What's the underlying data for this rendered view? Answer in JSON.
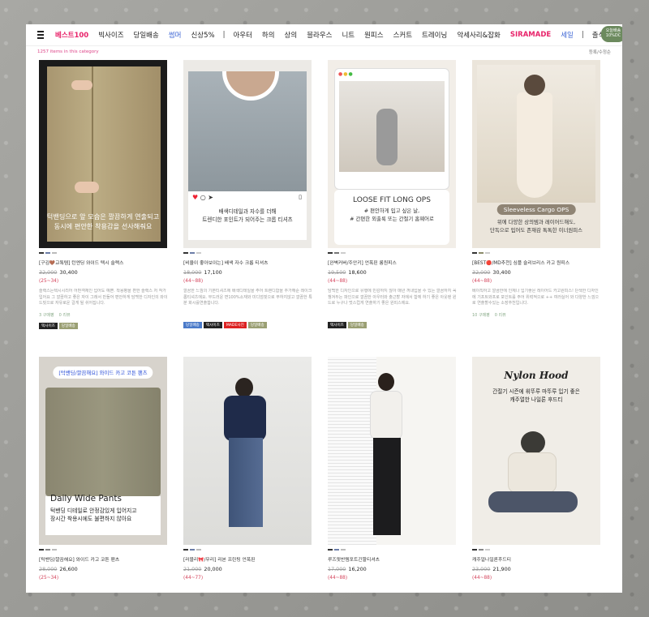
{
  "nav": {
    "items": [
      {
        "label": "베스트100",
        "color": "#e8236a",
        "bold": true
      },
      {
        "label": "빅사이즈",
        "color": "#222"
      },
      {
        "label": "당일배송",
        "color": "#222"
      },
      {
        "label": "썸머",
        "color": "#3b64d4"
      },
      {
        "label": "신상5%",
        "color": "#222"
      },
      {
        "label": "|",
        "sep": true
      },
      {
        "label": "아우터",
        "color": "#222"
      },
      {
        "label": "하의",
        "color": "#222"
      },
      {
        "label": "상의",
        "color": "#222"
      },
      {
        "label": "블라우스",
        "color": "#222"
      },
      {
        "label": "니트",
        "color": "#222"
      },
      {
        "label": "원피스",
        "color": "#222"
      },
      {
        "label": "스커트",
        "color": "#222"
      },
      {
        "label": "트레이닝",
        "color": "#222"
      },
      {
        "label": "악세사리&잡화",
        "color": "#222"
      },
      {
        "label": "SIRAMADE",
        "color": "#e8236a",
        "bold": true
      },
      {
        "label": "세일",
        "color": "#3b64d4"
      },
      {
        "label": "|",
        "sep": true
      },
      {
        "label": "출석체크",
        "color": "#222"
      }
    ],
    "today_badge": "오늘배송\n10%DC"
  },
  "subbar": {
    "count_text": "1257 items in this category",
    "sort_label": "등록/수정순"
  },
  "products": [
    {
      "name": "[구김🤎교톡템] 턴엔딩 와이드 텍시 슬랙스",
      "old_price": "32,000",
      "price": "30,400",
      "sale": "(25~34)",
      "desc": "슬랙스는텍시시리어 어떤객체인 입어도 예쁜. 착용평을 편한 슬랙스 저 작가입어요 그 깔끔하고 좋은 자이 그래서 만들어 편안하게 담백한 디자인의 와이드핏으로 자유로운 걸게 될 쉬어집니다.",
      "reviews": "3 구매평",
      "qna": "0 리뷰",
      "tags": [
        {
          "text": "택사이즈",
          "kind": "black"
        },
        {
          "text": "당일배송",
          "kind": "olive"
        }
      ],
      "colors": [
        "#333",
        "#6c7da8",
        "#bbb"
      ],
      "image_text": "턱밴딩으로 앞 모습은 깔끔하게 연출되고\n동시에 편안한 착용감을 선사해줘요"
    },
    {
      "name": "[비율이 좋아보이는] 배색 자수 크롭 티셔츠",
      "old_price": "18,000",
      "price": "17,100",
      "sale": "(44~88)",
      "desc": "깔끔한 느낌의 기본티셔츠에 배색디테일을 주어 트렌디함을 추가해준 레이크롭티셔츠에요. 부드러운 면100%소재와 미디엄핏으로 부하지않고 깔끔한 특분 화시를연출합니다.",
      "reviews": "",
      "qna": "",
      "tags": [
        {
          "text": "당일배송",
          "kind": "blue"
        },
        {
          "text": "택사이즈",
          "kind": "black"
        },
        {
          "text": "MADE사진",
          "kind": "red"
        },
        {
          "text": "당일배송",
          "kind": "olive"
        }
      ],
      "colors": [
        "#333",
        "#6c7da8",
        "#ccc"
      ],
      "image_text": "배색디테일과 자수를 더해\n트렌디한 포인트가 되어주는 크롭 티셔츠"
    },
    {
      "name": "[완벽커버/주안키] 언폭핀 롱원피스",
      "old_price": "19,500",
      "price": "18,600",
      "sale": "(44~88)",
      "desc": "담백한 디자인으로 유행에 민감하지 않아 매년 꺼내입을 수 있는 깔끔하지 꼭 챙겨두는 파인으로 깔끔한 아우터와 출근할 자에서 함께 하기 좋은 아웃텐 윈드로 누구나 멋스럽게 연출하기 좋은 원피스에요.",
      "reviews": "",
      "qna": "",
      "tags": [
        {
          "text": "택사이즈",
          "kind": "black"
        },
        {
          "text": "당일배송",
          "kind": "olive"
        }
      ],
      "colors": [
        "#333",
        "#777",
        "#ccc"
      ],
      "image_title": "LOOSE FIT LONG OPS",
      "image_text": "# 편안하게 입고 싶은 날,\n# 간편한 외출룩 또는 간절기 홈웨어로"
    },
    {
      "name": "[BEST🔴/MD추천] 심플 슬리브리스 카고 원피스",
      "old_price": "32,000",
      "price": "30,400",
      "sale": "(44~88)",
      "desc": "베이직하고 깔끔한에 인체나 입기좋은 레이어드 카고원피스! 단색한 디자인에 기프트와프로 포인트를 주어 위력적으로 ++ 여러실어 와 다양한 느낌으로 연출할수있는 소장추천입니다.",
      "reviews": "10 구매평",
      "qna": "0 리뷰",
      "tags": [],
      "colors": [
        "#333",
        "#8b8b6a",
        "#ccc"
      ],
      "image_title": "Sleeveless Cargo OPS",
      "image_text": "위에 다양한 상의템과 레이어드해도,\n단독으로 입어도 존재감 톡톡한 이너원피스"
    },
    {
      "name": "[턱밴딩/깔끔해요] 와이드 카고 코튼 팬츠",
      "old_price": "28,000",
      "price": "26,600",
      "sale": "(25~34)",
      "desc": "",
      "reviews": "",
      "qna": "",
      "tags": [],
      "colors": [
        "#333",
        "#888",
        "#bbb"
      ],
      "image_pill": "[턱밴딩/깔끔해요] 와이드 카고 코튼 팬츠",
      "image_title": "Daily Wide Pants",
      "image_text": "턱밴딩 디테일로 안정감있게 입어지고\n장시간 착용시에도 불편하지 않아요"
    },
    {
      "name": "[러블리🎀/무리] 리본 프린팅 언폭핀",
      "old_price": "21,000",
      "price": "20,000",
      "sale": "(44~77)",
      "desc": "",
      "reviews": "",
      "qna": "",
      "tags": [],
      "colors": [
        "#333",
        "#6c7da8",
        "#bbb"
      ]
    },
    {
      "name": "루즈핏반템포트긴팔티셔츠",
      "old_price": "17,000",
      "price": "16,200",
      "sale": "(44~88)",
      "desc": "",
      "reviews": "",
      "qna": "",
      "tags": [],
      "colors": [
        "#333",
        "#6c7da8",
        "#bbb"
      ]
    },
    {
      "name": "캐주얼나일론후드티",
      "old_price": "23,000",
      "price": "21,900",
      "sale": "(44~88)",
      "desc": "",
      "reviews": "",
      "qna": "",
      "tags": [],
      "colors": [
        "#333",
        "#888",
        "#ccc"
      ],
      "image_title": "Nylon Hood",
      "image_text": "간절기 시즌에 휘뚜루 마뚜루 입기 좋은\n캐주얼한 나일론 후드티"
    }
  ]
}
